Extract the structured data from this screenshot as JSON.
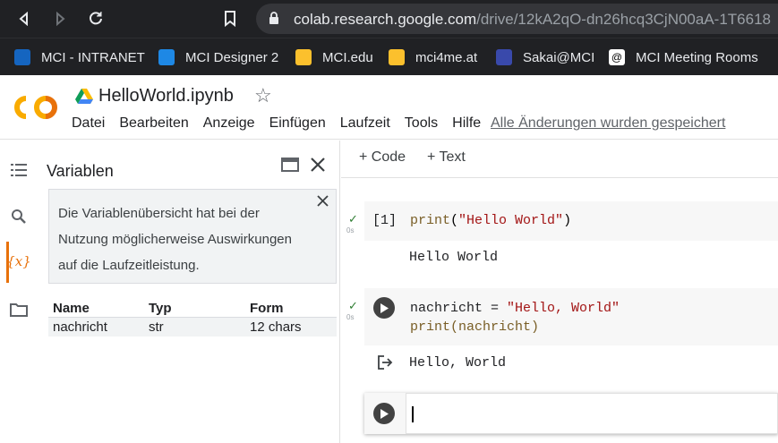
{
  "browser": {
    "url_host": "colab.research.google.com",
    "url_path": "/drive/12kA2qO-dn26hcq3CjN00aA-1T6618",
    "bookmarks": [
      {
        "label": "MCI - INTRANET",
        "color": "#1565c0"
      },
      {
        "label": "MCI Designer 2",
        "color": "#1e88e5"
      },
      {
        "label": "MCI.edu",
        "color": "#fbc02d"
      },
      {
        "label": "mci4me.at",
        "color": "#fbc02d"
      },
      {
        "label": "Sakai@MCI",
        "color": "#3949ab"
      },
      {
        "label": "MCI Meeting Rooms",
        "color": "#ffffff"
      }
    ]
  },
  "colab": {
    "logo": "CO",
    "notebook_title": "HelloWorld.ipynb",
    "menu": [
      "Datei",
      "Bearbeiten",
      "Anzeige",
      "Einfügen",
      "Laufzeit",
      "Tools",
      "Hilfe"
    ],
    "save_status": "Alle Änderungen wurden gespeichert",
    "accent": "#e8710a"
  },
  "variables_panel": {
    "title": "Variablen",
    "info_text": "Die Variablenübersicht hat bei der Nutzung möglicherweise Auswirkungen auf die Laufzeitleistung.",
    "columns": [
      "Name",
      "Typ",
      "Form"
    ],
    "rows": [
      {
        "name": "nachricht",
        "type": "str",
        "shape": "12 chars"
      }
    ]
  },
  "rail": {
    "toc_icon": "list-icon",
    "search_icon": "search-icon",
    "variables_icon": "{x}",
    "files_icon": "folder-icon"
  },
  "notebook": {
    "add_code": "+ Code",
    "add_text": "+ Text",
    "cells": [
      {
        "exec_count": "[1]",
        "time": "0s",
        "code_fn": "print",
        "code_str": "\"Hello World\"",
        "output": "Hello World"
      },
      {
        "time": "0s",
        "line1_var": "nachricht = ",
        "line1_str": "\"Hello, World\"",
        "line2": "print(nachricht)",
        "output": "Hello, World"
      }
    ]
  }
}
